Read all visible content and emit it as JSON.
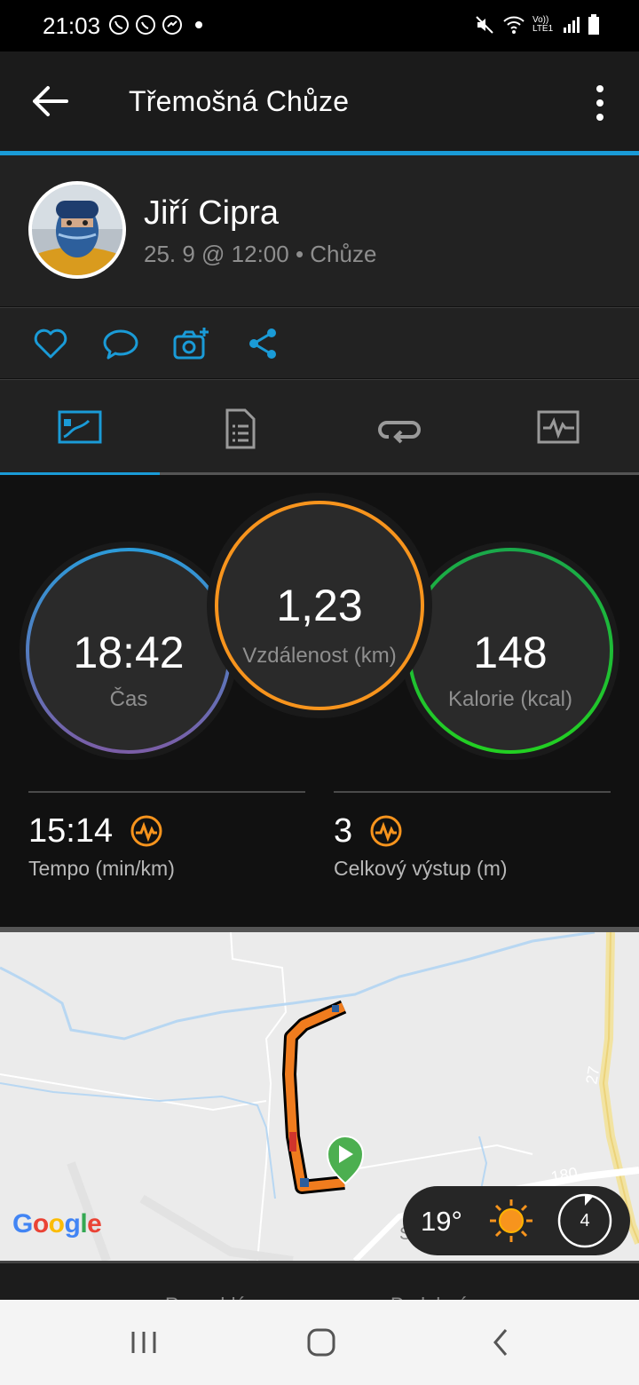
{
  "status_bar": {
    "time": "21:03",
    "left_icons": [
      "viber-icon",
      "whatsapp-icon",
      "messenger-icon",
      "dot-icon"
    ],
    "right_icons": [
      "mute-icon",
      "wifi-icon",
      "volte-icon",
      "signal-icon",
      "battery-icon"
    ],
    "volte_label": "Vo)) LTE1"
  },
  "header": {
    "title": "Třemošná Chůze",
    "back_icon": "arrow-left-icon",
    "menu_icon": "more-vertical-icon"
  },
  "profile": {
    "name": "Jiří Cipra",
    "meta": "25. 9 @ 12:00 • Chůze"
  },
  "actions": [
    "like-icon",
    "comment-icon",
    "add-photo-icon",
    "share-icon"
  ],
  "tabs": [
    {
      "icon": "overview-icon",
      "active": true
    },
    {
      "icon": "details-icon",
      "active": false
    },
    {
      "icon": "laps-icon",
      "active": false
    },
    {
      "icon": "charts-icon",
      "active": false
    }
  ],
  "rings": {
    "time": {
      "value": "18:42",
      "label": "Čas"
    },
    "distance": {
      "value": "1,23",
      "label": "Vzdálenost (km)"
    },
    "calories": {
      "value": "148",
      "label": "Kalorie (kcal)"
    }
  },
  "metrics": {
    "pace": {
      "value": "15:14",
      "label": "Tempo (min/km)",
      "icon": "chart-badge-icon"
    },
    "ascent": {
      "value": "3",
      "label": "Celkový výstup (m)",
      "icon": "chart-badge-icon"
    }
  },
  "map": {
    "logo": "Google",
    "road_27": "27",
    "road_180": "180",
    "start_icon": "play-marker-icon"
  },
  "weather": {
    "temp": "19°",
    "icon": "sun-icon",
    "wind": "4"
  },
  "bottom_peek": {
    "left": "Rozsahlá…",
    "right": "Podobná…"
  },
  "colors": {
    "accent": "#1a9bd7",
    "distance_ring": "#f7941d",
    "calorie_ring": "#2ecc40",
    "time_ring_top": "#2c9ad8",
    "time_ring_bottom": "#7b5ea7",
    "route": "#f07c1e"
  }
}
